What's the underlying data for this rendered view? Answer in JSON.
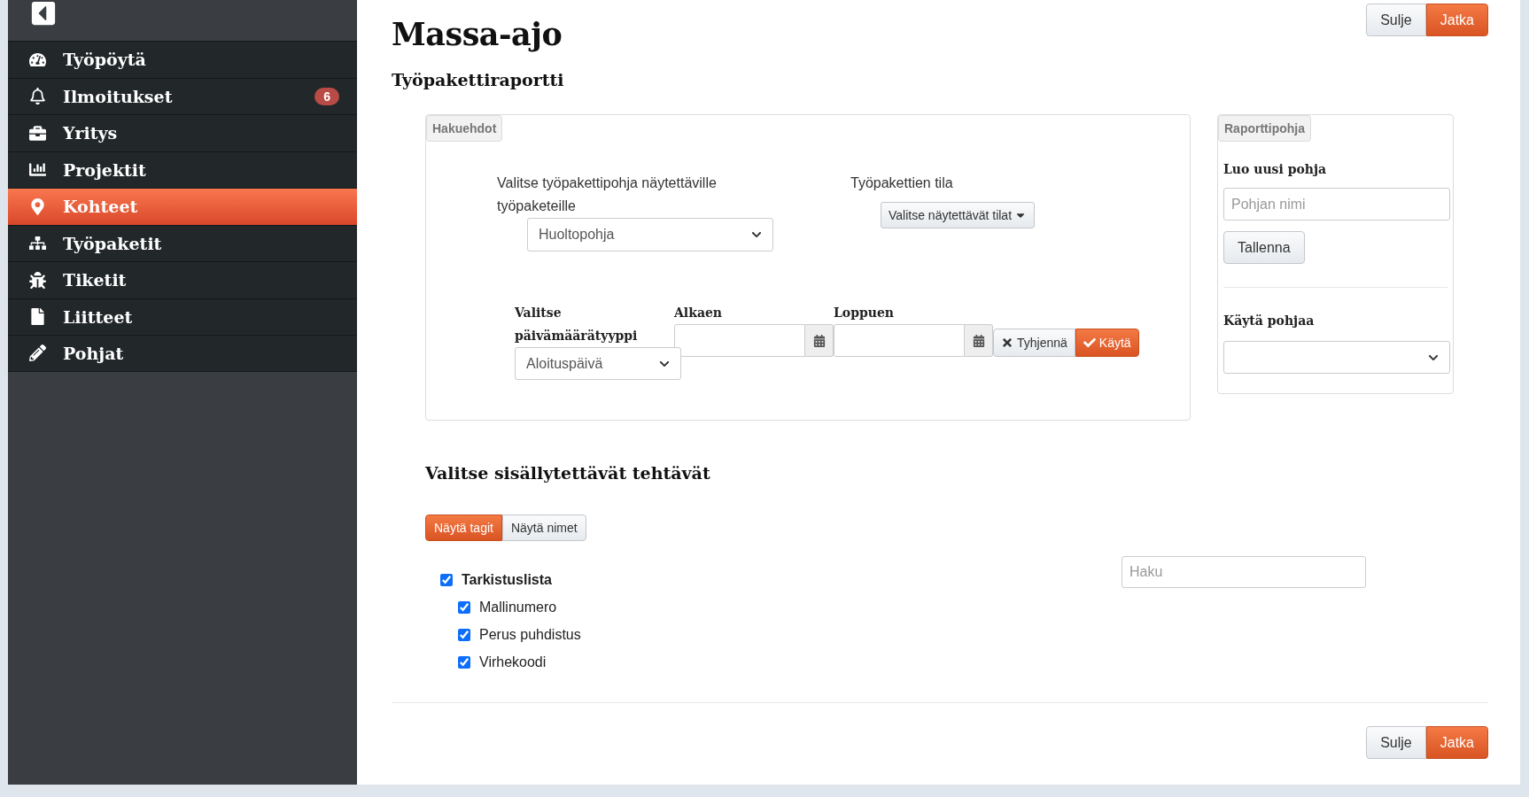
{
  "sidebar": {
    "items": [
      {
        "label": "Työpöytä",
        "selected": false
      },
      {
        "label": "Ilmoitukset",
        "selected": false,
        "badge": "6"
      },
      {
        "label": "Yritys",
        "selected": false
      },
      {
        "label": "Projektit",
        "selected": false
      },
      {
        "label": "Kohteet",
        "selected": true
      },
      {
        "label": "Työpaketit",
        "selected": false
      },
      {
        "label": "Tiketit",
        "selected": false
      },
      {
        "label": "Liitteet",
        "selected": false
      },
      {
        "label": "Pohjat",
        "selected": false
      }
    ]
  },
  "page": {
    "title": "Massa-ajo",
    "subtitle": "Työpakettiraportti",
    "header_buttons": [
      {
        "label": "Sulje",
        "kind": "default"
      },
      {
        "label": "Jatka",
        "kind": "primary"
      }
    ]
  },
  "search_criteria": {
    "legend": "Hakuehdot",
    "template_label": "Valitse työpakettipohja näytettäville työpaketeille",
    "template_select": {
      "value": "Huoltopohja"
    },
    "status_label": "Työpakettien tila",
    "status_dropdown": {
      "label": "Valitse näytettävät tilat"
    },
    "date_type_label": "Valitse päivämäärätyyppi",
    "date_type_select": {
      "value": "Aloituspäivä"
    },
    "start_label": "Alkaen",
    "end_label": "Loppuen",
    "clear_button": "Tyhjennä",
    "apply_button": "Käytä"
  },
  "report_template": {
    "legend": "Raporttipohja",
    "create_heading": "Luo uusi pohja",
    "name_field": {
      "placeholder": "Pohjan nimi"
    },
    "save_button": "Tallenna",
    "use_heading": "Käytä pohjaa"
  },
  "tasks": {
    "heading": "Valitse sisällytettävät tehtävät",
    "view_toggle": [
      {
        "label": "Näytä tagit",
        "selected": true
      },
      {
        "label": "Näytä nimet",
        "selected": false
      }
    ],
    "search": {
      "placeholder": "Haku"
    },
    "tree": [
      {
        "label": "Tarkistuslista",
        "checked": true,
        "children": [
          {
            "label": "Mallinumero",
            "checked": true
          },
          {
            "label": "Perus puhdistus",
            "checked": true
          },
          {
            "label": "Virhekoodi",
            "checked": true
          }
        ]
      }
    ]
  },
  "footer_buttons": [
    {
      "label": "Sulje",
      "kind": "default"
    },
    {
      "label": "Jatka",
      "kind": "primary"
    }
  ]
}
